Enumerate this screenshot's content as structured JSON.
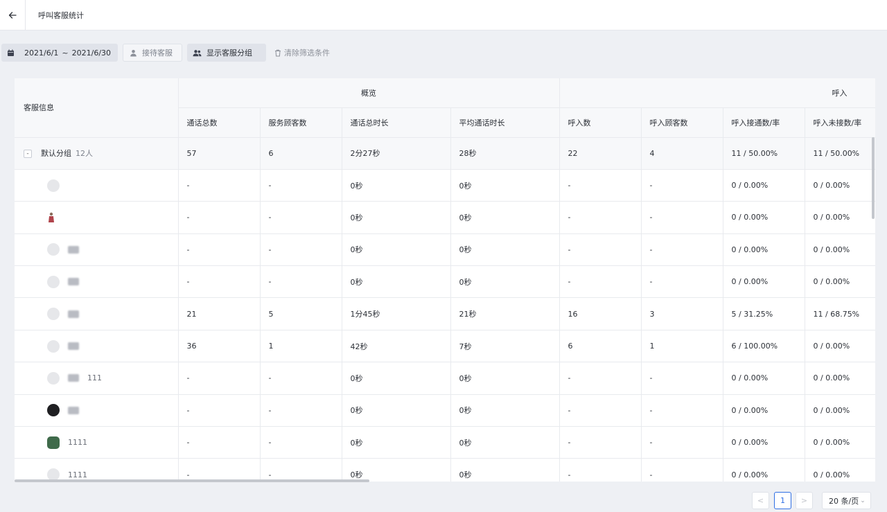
{
  "header": {
    "title": "呼叫客服统计"
  },
  "filters": {
    "date_start": "2021/6/1",
    "date_sep": "~",
    "date_end": "2021/6/30",
    "agent_label": "接待客服",
    "group_label": "显示客服分组",
    "clear_label": "清除筛选条件"
  },
  "table": {
    "info_header": "客服信息",
    "group_headers": {
      "overview": "概览",
      "inbound": "呼入"
    },
    "columns": [
      "通话总数",
      "服务顾客数",
      "通话总时长",
      "平均通话时长",
      "呼入数",
      "呼入顾客数",
      "呼入接通数/率",
      "呼入未接数/率"
    ],
    "group_row": {
      "toggle": "-",
      "name": "默认分组",
      "count": "12人",
      "cells": [
        "57",
        "6",
        "2分27秒",
        "28秒",
        "22",
        "4",
        "11 / 50.00%",
        "11 / 50.00%"
      ]
    },
    "rows": [
      {
        "name": "",
        "cells": [
          "-",
          "-",
          "0秒",
          "0秒",
          "-",
          "-",
          "0 / 0.00%",
          "0 / 0.00%"
        ]
      },
      {
        "name": "",
        "cells": [
          "-",
          "-",
          "0秒",
          "0秒",
          "-",
          "-",
          "0 / 0.00%",
          "0 / 0.00%"
        ]
      },
      {
        "name": "",
        "cells": [
          "-",
          "-",
          "0秒",
          "0秒",
          "-",
          "-",
          "0 / 0.00%",
          "0 / 0.00%"
        ]
      },
      {
        "name": "",
        "cells": [
          "-",
          "-",
          "0秒",
          "0秒",
          "-",
          "-",
          "0 / 0.00%",
          "0 / 0.00%"
        ]
      },
      {
        "name": "",
        "cells": [
          "21",
          "5",
          "1分45秒",
          "21秒",
          "16",
          "3",
          "5 / 31.25%",
          "11 / 68.75%"
        ]
      },
      {
        "name": "",
        "cells": [
          "36",
          "1",
          "42秒",
          "7秒",
          "6",
          "1",
          "6 / 100.00%",
          "0 / 0.00%"
        ]
      },
      {
        "name": "111",
        "cells": [
          "-",
          "-",
          "0秒",
          "0秒",
          "-",
          "-",
          "0 / 0.00%",
          "0 / 0.00%"
        ]
      },
      {
        "name": "",
        "cells": [
          "-",
          "-",
          "0秒",
          "0秒",
          "-",
          "-",
          "0 / 0.00%",
          "0 / 0.00%"
        ]
      },
      {
        "name": "1111",
        "cells": [
          "-",
          "-",
          "0秒",
          "0秒",
          "-",
          "-",
          "0 / 0.00%",
          "0 / 0.00%"
        ]
      },
      {
        "name": "1111",
        "cells": [
          "-",
          "-",
          "0秒",
          "0秒",
          "-",
          "-",
          "0 / 0.00%",
          "0 / 0.00%"
        ]
      }
    ]
  },
  "pagination": {
    "prev": "<",
    "current": "1",
    "next": ">",
    "page_size": "20 条/页"
  },
  "colors": {
    "accent": "#2f6fe4",
    "border": "#e8eaee",
    "header_bg": "#f7f8fa"
  }
}
